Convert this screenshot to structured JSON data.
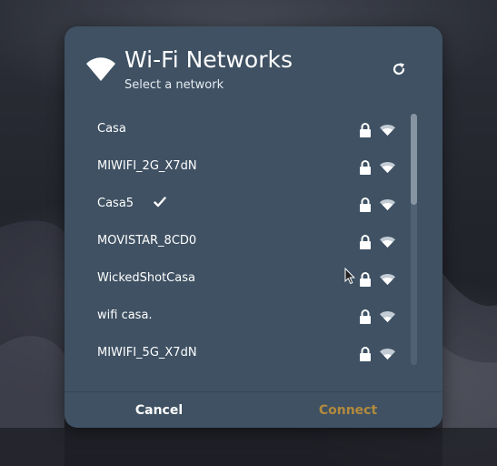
{
  "dialog": {
    "title": "Wi-Fi Networks",
    "subtitle": "Select a network",
    "header_icon": "wifi-icon",
    "refresh_icon": "refresh-icon"
  },
  "networks": [
    {
      "name": "Casa",
      "secured": true,
      "connected": false
    },
    {
      "name": "MIWIFI_2G_X7dN",
      "secured": true,
      "connected": false
    },
    {
      "name": "Casa5",
      "secured": true,
      "connected": true
    },
    {
      "name": "MOVISTAR_8CD0",
      "secured": true,
      "connected": false
    },
    {
      "name": "WickedShotCasa",
      "secured": true,
      "connected": false
    },
    {
      "name": "wifi casa.",
      "secured": true,
      "connected": false
    },
    {
      "name": "MIWIFI_5G_X7dN",
      "secured": true,
      "connected": false
    }
  ],
  "actions": {
    "cancel_label": "Cancel",
    "connect_label": "Connect"
  },
  "colors": {
    "dialog_bg": "#3f5163",
    "text": "#ffffff",
    "connect_disabled": "#b38a3d",
    "scroll_thumb": "#8795a3"
  }
}
